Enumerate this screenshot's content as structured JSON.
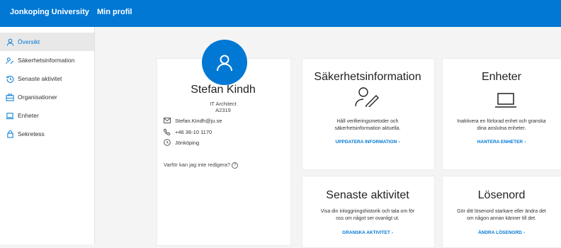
{
  "header": {
    "brand": "Jonkoping University",
    "app_title": "Min profil"
  },
  "sidebar": {
    "items": [
      {
        "label": "Översikt",
        "icon": "person-icon",
        "active": true
      },
      {
        "label": "Säkerhetsinformation",
        "icon": "security-info-icon"
      },
      {
        "label": "Senaste aktivitet",
        "icon": "history-icon"
      },
      {
        "label": "Organisationer",
        "icon": "organization-icon"
      },
      {
        "label": "Enheter",
        "icon": "laptop-icon"
      },
      {
        "label": "Sekretess",
        "icon": "lock-icon"
      }
    ]
  },
  "profile": {
    "name": "Stefan Kindh",
    "title": "IT Architect",
    "code": "A2319",
    "email": "Stefan.Kindh@ju.se",
    "phone": "+46 36-10 1170",
    "location": "Jönköping",
    "why_edit": "Varför kan jag inte redigera?"
  },
  "tiles": {
    "security": {
      "title": "Säkerhetsinformation",
      "desc1": "Håll verifieringsmetoder och",
      "desc2": "säkerhetsinformation aktuella.",
      "link": "UPPDATERA INFORMATION"
    },
    "devices": {
      "title": "Enheter",
      "desc1": "Inaktivera en förlorad enhet och granska",
      "desc2": "dina anslutna enheter.",
      "link": "HANTERA ENHETER"
    },
    "activity": {
      "title": "Senaste aktivitet",
      "desc1": "Visa din inloggningshistorik och tala om för",
      "desc2": "oss om något ser ovanligt ut.",
      "link": "GRANSKA AKTIVITET"
    },
    "password": {
      "title": "Lösenord",
      "desc1": "Gör ditt lösenord starkare eller ändra det",
      "desc2": "om någon annan känner till det.",
      "link": "ÄNDRA LÖSENORD"
    }
  },
  "colors": {
    "accent": "#0078d4",
    "page_bg": "#f4f4f4"
  }
}
